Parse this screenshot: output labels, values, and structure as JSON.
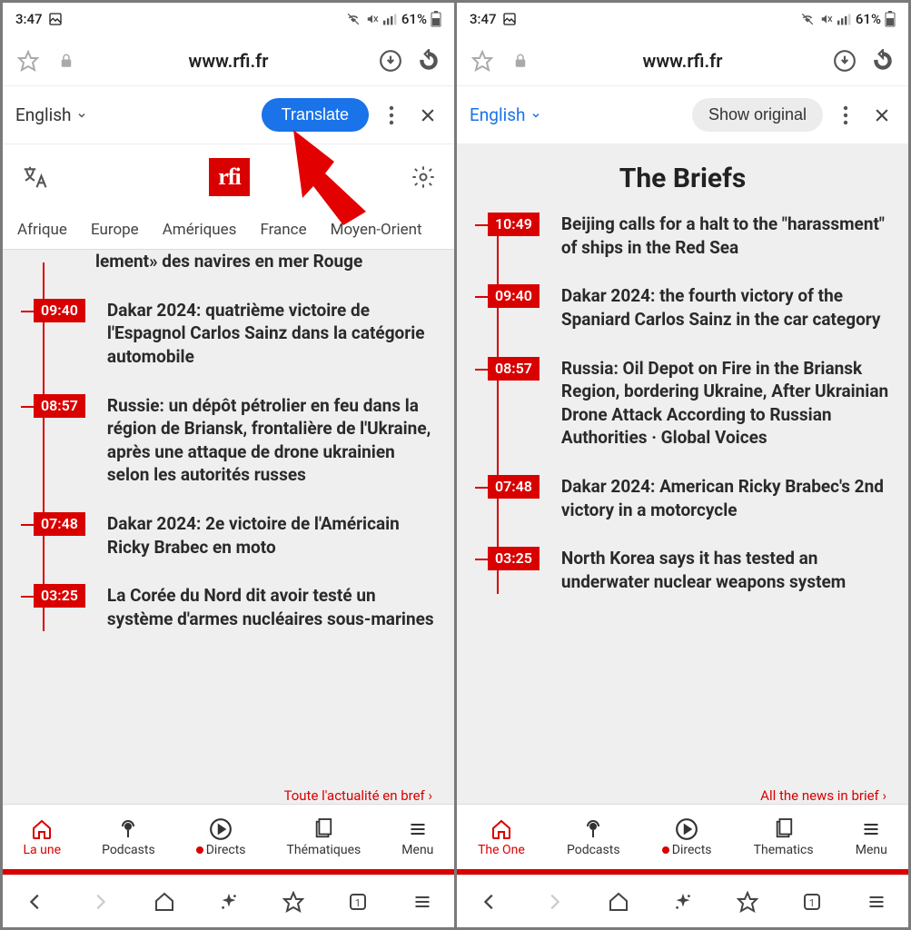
{
  "status": {
    "time": "3:47",
    "battery": "61%"
  },
  "urlbar": {
    "url": "www.rfi.fr"
  },
  "left": {
    "translate": {
      "lang": "English",
      "action": "Translate"
    },
    "logo": "rfi",
    "tabs": [
      "Afrique",
      "Europe",
      "Amériques",
      "France",
      "Moyen-Orient"
    ],
    "partial_headline": "lement» des navires en mer Rouge",
    "items": [
      {
        "time": "09:40",
        "headline": "Dakar 2024: quatrième victoire de l'Espagnol Carlos Sainz dans la catégorie automobile"
      },
      {
        "time": "08:57",
        "headline": "Russie: un dépôt pétrolier en feu dans la région de Briansk, frontalière de l'Ukraine, après une attaque de drone ukrainien selon les autorités russes"
      },
      {
        "time": "07:48",
        "headline": "Dakar 2024: 2e victoire de l'Américain Ricky Brabec en moto"
      },
      {
        "time": "03:25",
        "headline": "La Corée du Nord dit avoir testé un système d'armes nucléaires sous-marines"
      }
    ],
    "more": "Toute l'actualité en bref",
    "bottomnav": [
      "La une",
      "Podcasts",
      "Directs",
      "Thématiques",
      "Menu"
    ]
  },
  "right": {
    "translate": {
      "lang": "English",
      "action": "Show original"
    },
    "section_title": "The Briefs",
    "items": [
      {
        "time": "10:49",
        "headline": "Beijing calls for a halt to the \"harassment\" of ships in the Red Sea"
      },
      {
        "time": "09:40",
        "headline": "Dakar 2024: the fourth victory of the Spaniard Carlos Sainz in the car category"
      },
      {
        "time": "08:57",
        "headline": "Russia: Oil Depot on Fire in the Briansk Region, bordering Ukraine, After Ukrainian Drone Attack According to Russian Authorities · Global Voices"
      },
      {
        "time": "07:48",
        "headline": "Dakar 2024: American Ricky Brabec's 2nd victory in a motorcycle"
      },
      {
        "time": "03:25",
        "headline": "North Korea says it has tested an underwater nuclear weapons system"
      }
    ],
    "more": "All the news in brief",
    "bottomnav": [
      "The One",
      "Podcasts",
      "Directs",
      "Thematics",
      "Menu"
    ]
  }
}
